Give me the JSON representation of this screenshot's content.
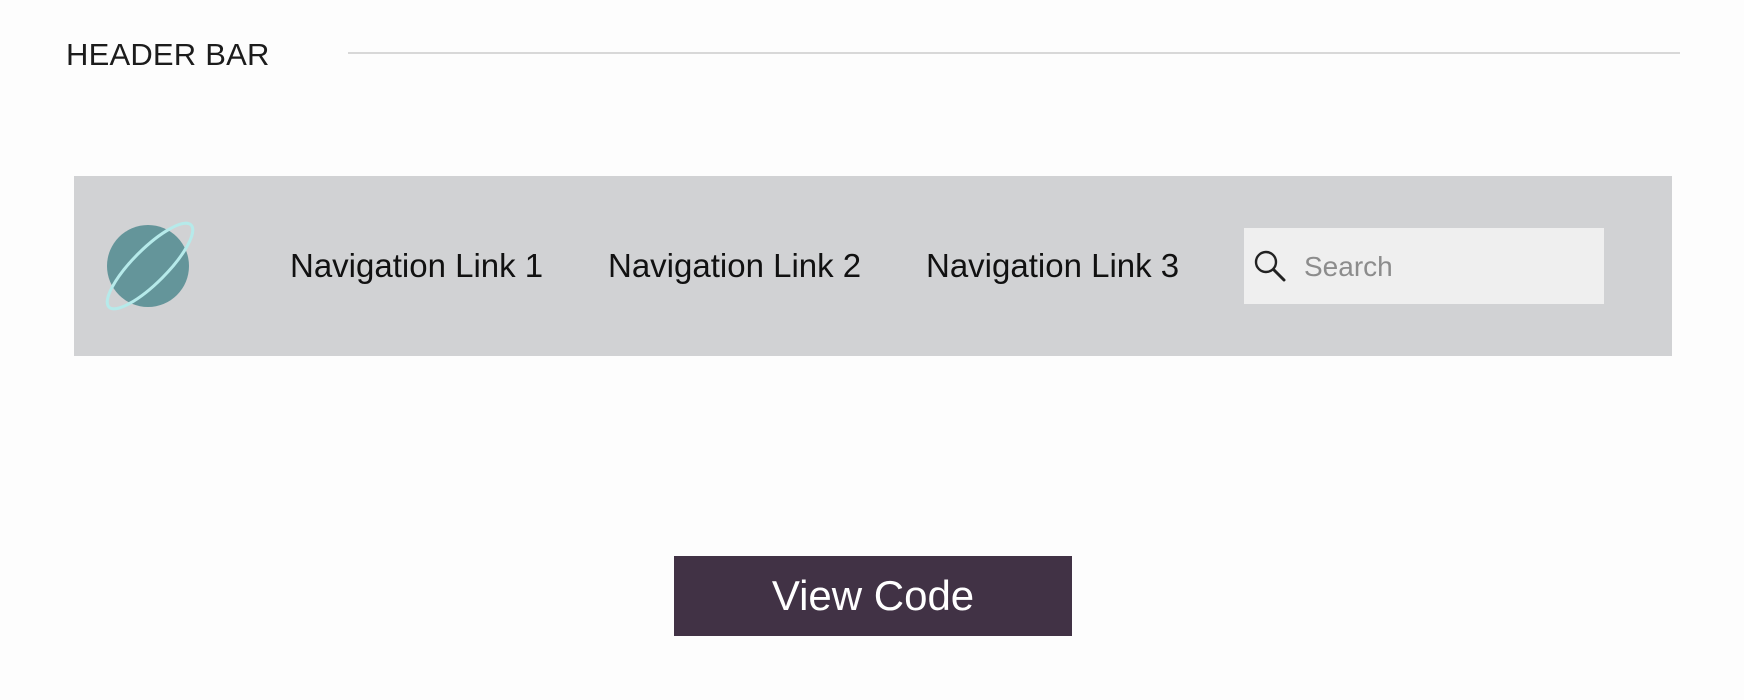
{
  "section": {
    "title": "HEADER BAR"
  },
  "navbar": {
    "logo_icon": "planet-icon",
    "links": [
      {
        "label": "Navigation Link 1"
      },
      {
        "label": "Navigation Link 2"
      },
      {
        "label": "Navigation Link 3"
      }
    ],
    "search": {
      "icon": "search-icon",
      "placeholder": "Search",
      "value": ""
    },
    "background_color": "#d1d2d4"
  },
  "actions": {
    "view_code_label": "View Code",
    "view_code_color": "#413245"
  },
  "colors": {
    "planet": "#64959a",
    "ring": "#b6eaea",
    "search_bg": "#efefef"
  }
}
